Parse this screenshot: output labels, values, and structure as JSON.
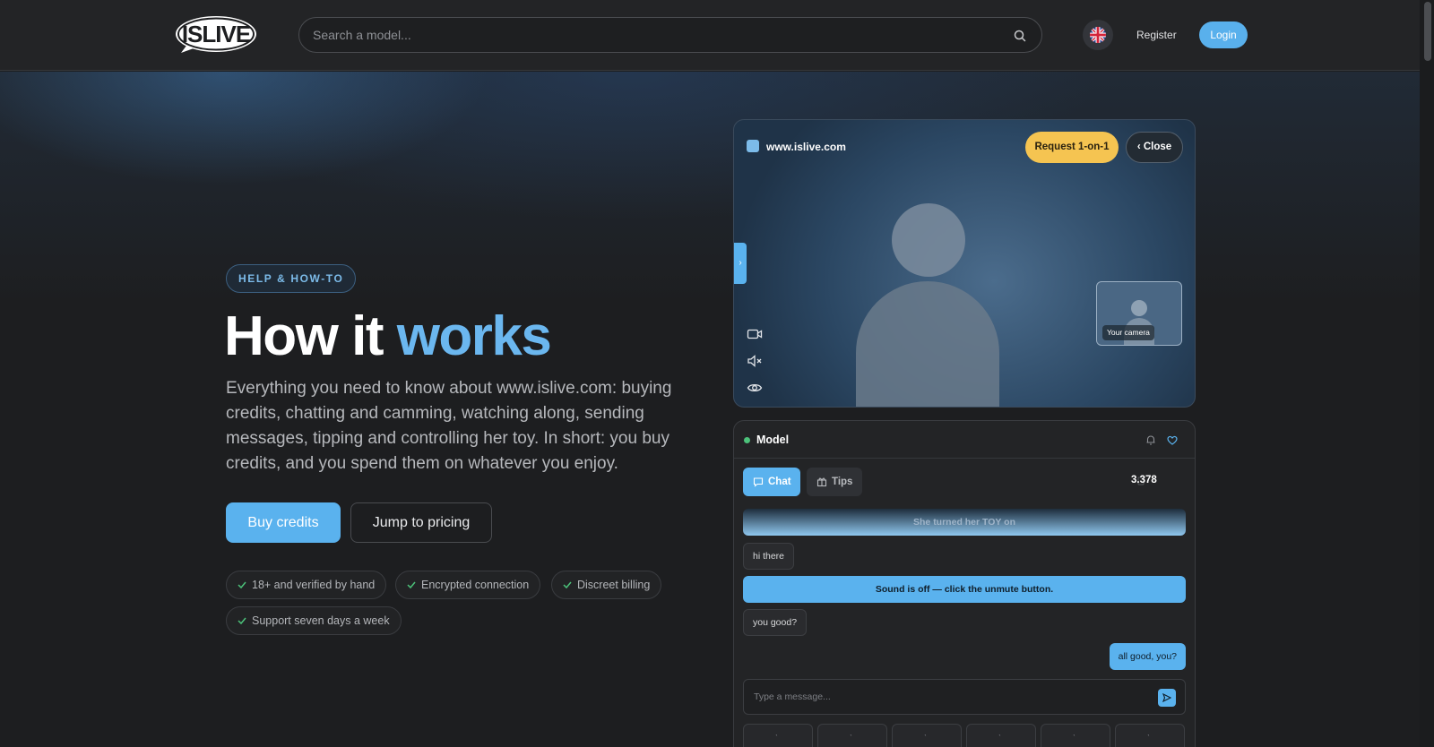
{
  "header": {
    "logo_text": "ISLIVE",
    "search_placeholder": "Search a model...",
    "register": "Register",
    "login": "Login"
  },
  "hero": {
    "badge": "HELP & HOW-TO",
    "title_main": "How it ",
    "title_accent": "works",
    "description": "Everything you need to know about www.islive.com: buying credits, chatting and camming, watching along, sending messages, tipping and controlling her toy. In short: you buy credits, and you spend them on whatever you enjoy.",
    "buy_button": "Buy credits",
    "jump_button": "Jump to pricing",
    "chips": [
      "18+ and verified by hand",
      "Encrypted connection",
      "Discreet billing",
      "Support seven days a week"
    ]
  },
  "video": {
    "url": "www.islive.com",
    "request_button": "Request 1-on-1",
    "close_button": "‹ Close",
    "side_tab": "›",
    "pip_label": "Your camera"
  },
  "chat": {
    "model_name": "Model",
    "tab_chat": "Chat",
    "tab_tips": "Tips",
    "credits": "3.378",
    "messages": {
      "system_toy": "She turned her TOY on",
      "in1": "hi there",
      "system_sound": "Sound is off — click the unmute button.",
      "in2": "you good?",
      "out1": "all good, you?"
    },
    "input_placeholder": "Type a message..."
  },
  "colors": {
    "accent": "#5ab2ee",
    "gold": "#f5c451",
    "online": "#4cc27a"
  }
}
